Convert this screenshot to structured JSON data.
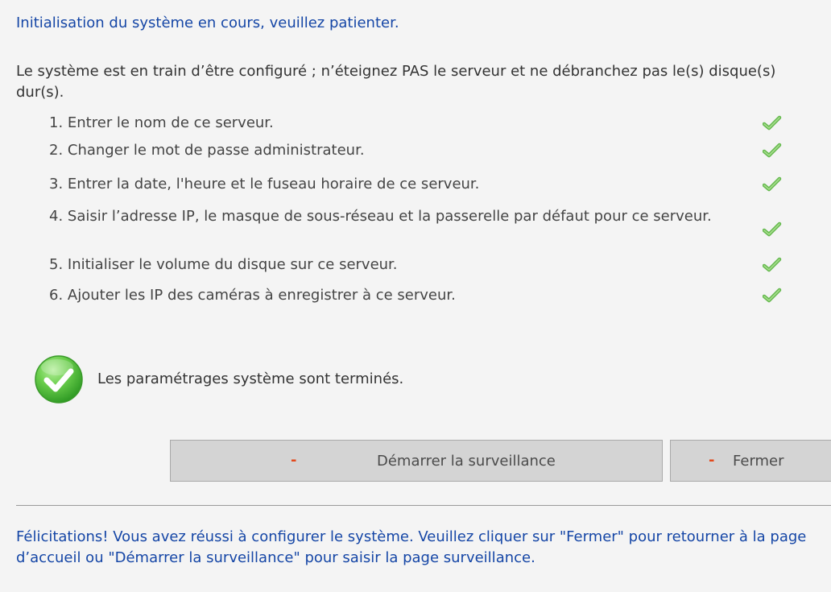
{
  "header": {
    "title": "Initialisation du système en cours, veuillez patienter."
  },
  "warning": "Le système est en train d’être configuré ; n’éteignez PAS le serveur et ne débranchez pas le(s) disque(s) dur(s).",
  "steps": [
    {
      "label": "1. Entrer le nom de ce serveur.",
      "status_icon": "check-icon"
    },
    {
      "label": "2. Changer le mot de passe administrateur.",
      "status_icon": "check-icon"
    },
    {
      "label": "3. Entrer la date, l'heure et le fuseau horaire de ce serveur.",
      "status_icon": "check-icon"
    },
    {
      "label": "4. Saisir l’adresse IP, le masque de sous-réseau et la passerelle par défaut pour ce serveur.",
      "status_icon": "check-icon"
    },
    {
      "label": "5. Initialiser le volume du disque sur ce serveur.",
      "status_icon": "check-icon"
    },
    {
      "label": "6. Ajouter les IP des caméras à enregistrer à ce serveur.",
      "status_icon": "check-icon"
    }
  ],
  "completion": {
    "icon": "success-check-icon",
    "message": "Les paramétrages système sont terminés."
  },
  "buttons": {
    "start_label": "Démarrer la surveillance",
    "close_label": "Fermer",
    "prefix": "-"
  },
  "footer": {
    "message": "Félicitations! Vous avez réussi à configurer le système. Veuillez cliquer sur \"Fermer\" pour retourner à la page d’accueil ou \"Démarrer la surveillance\" pour saisir la page surveillance."
  },
  "colors": {
    "heading_blue": "#1546a6",
    "check_green": "#58b73e",
    "button_bg": "#d4d4d4",
    "button_dash": "#e34a1d"
  }
}
